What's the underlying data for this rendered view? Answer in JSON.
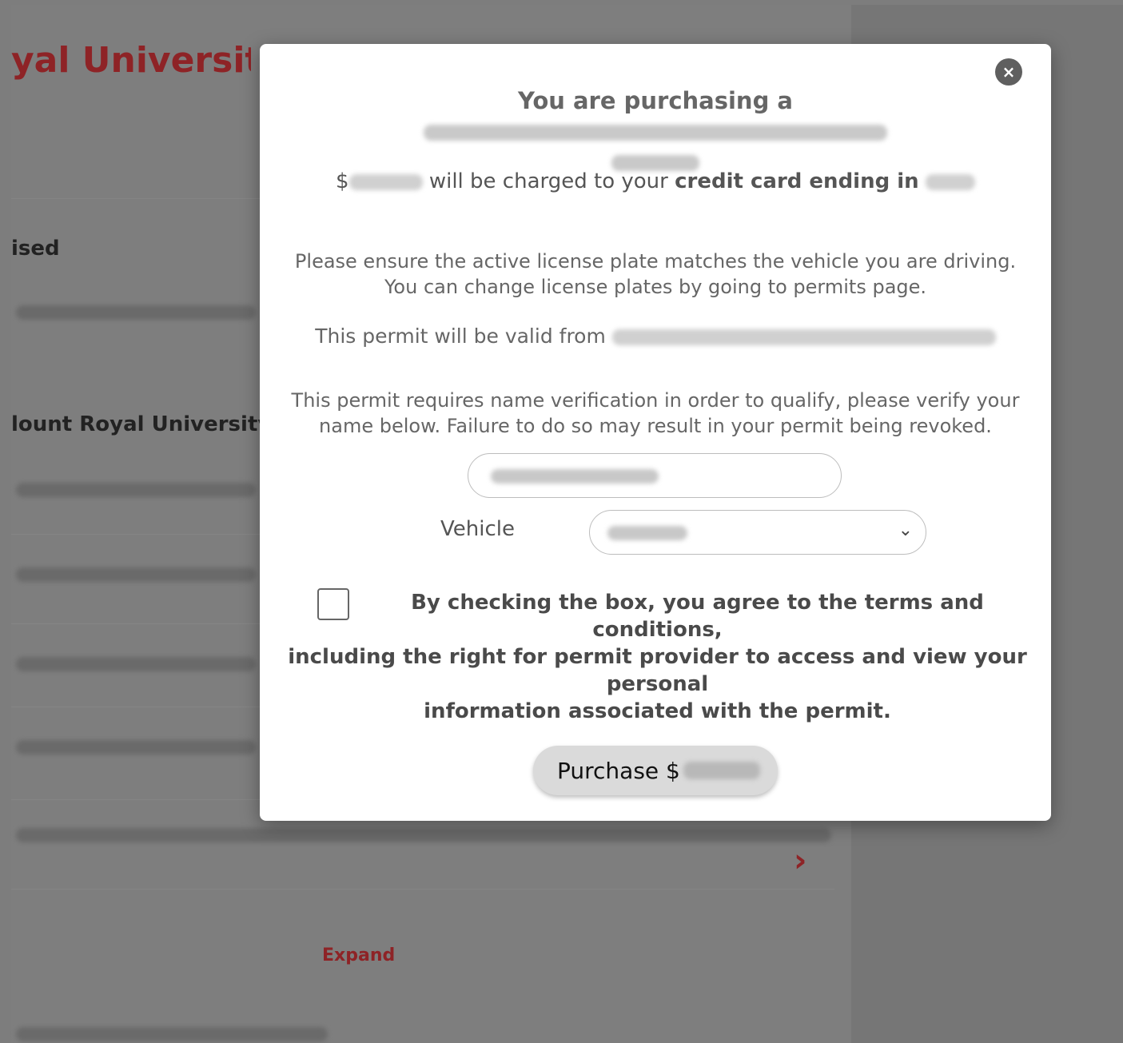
{
  "background": {
    "title": "yal University",
    "section1_heading": "ised",
    "section2_heading": "lount Royal University pe",
    "expand_label": "Expand",
    "chevron": "›"
  },
  "modal": {
    "close_label": "×",
    "purchasing_prefix": "You are purchasing a",
    "charge_prefix": "$",
    "charge_middle": "will be charged to your",
    "charge_bold": "credit card ending in",
    "plate_note_line1": "Please ensure the active license plate matches the vehicle you are driving.",
    "plate_note_line2": "You can change license plates by going to permits page.",
    "valid_prefix": "This permit will be valid from",
    "verify_line1": "This permit requires name verification in order to qualify, please verify your",
    "verify_line2": "name below. Failure to do so may result in your permit being revoked.",
    "vehicle_label": "Vehicle",
    "terms_line1": "By checking the box, you agree to the terms and conditions,",
    "terms_line2": "including the right for permit provider to access and view your personal",
    "terms_line3": "information associated with the permit.",
    "purchase_label": "Purchase $"
  },
  "colors": {
    "brand_red": "#8e2326",
    "overlay": "#7d7d7d",
    "button_bg": "#dadada"
  }
}
